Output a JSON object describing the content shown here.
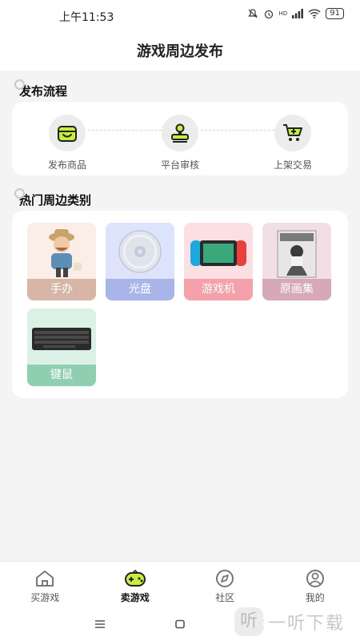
{
  "status_bar": {
    "time": "上午11:53",
    "signal": "HD",
    "battery": "91"
  },
  "header": {
    "title": "游戏周边发布"
  },
  "process": {
    "title": "发布流程",
    "steps": [
      {
        "label": "发布商品",
        "icon": "shopping-bag-icon"
      },
      {
        "label": "平台审核",
        "icon": "stamp-icon"
      },
      {
        "label": "上架交易",
        "icon": "cart-add-icon"
      }
    ]
  },
  "categories": {
    "title": "热门周边类别",
    "items": [
      {
        "label": "手办",
        "icon": "figure-toy-image",
        "color": "#d7b6a7",
        "bg": "#fbeee6"
      },
      {
        "label": "光盘",
        "icon": "disc-image",
        "color": "#a9b4e8",
        "bg": "#dde3fb"
      },
      {
        "label": "游戏机",
        "icon": "handheld-console-image",
        "color": "#f4a1ab",
        "bg": "#fbdfe2"
      },
      {
        "label": "原画集",
        "icon": "artbook-image",
        "color": "#d7a9b8",
        "bg": "#f2dfe6"
      },
      {
        "label": "键鼠",
        "icon": "keyboard-image",
        "color": "#8fcfb0",
        "bg": "#dbf1e6"
      }
    ]
  },
  "tabbar": {
    "tabs": [
      {
        "label": "买游戏",
        "icon": "home-icon"
      },
      {
        "label": "卖游戏",
        "icon": "gamepad-icon",
        "active": true
      },
      {
        "label": "社区",
        "icon": "compass-icon"
      },
      {
        "label": "我的",
        "icon": "user-icon"
      }
    ]
  },
  "watermark": {
    "text": "一听下载",
    "logo": "听"
  },
  "colors": {
    "accent": "#c6ef3b",
    "dark": "#222222"
  }
}
